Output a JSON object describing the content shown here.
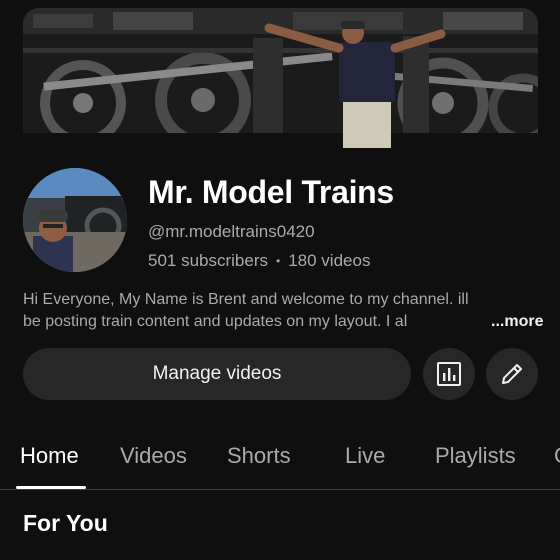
{
  "channel": {
    "name": "Mr. Model Trains",
    "handle": "@mr.modeltrains0420",
    "subscribers": "501 subscribers",
    "separator": "•",
    "videos": "180 videos",
    "description_line1": "Hi Everyone, My Name is Brent and welcome to my channel. ill",
    "description_line2": "be posting train content and updates on my layout. I al",
    "more_label": "...more"
  },
  "actions": {
    "manage_label": "Manage videos",
    "analytics_icon": "analytics-icon",
    "edit_icon": "pencil-icon"
  },
  "tabs": [
    {
      "label": "Home",
      "active": true
    },
    {
      "label": "Videos",
      "active": false
    },
    {
      "label": "Shorts",
      "active": false
    },
    {
      "label": "Live",
      "active": false
    },
    {
      "label": "Playlists",
      "active": false
    },
    {
      "label": "C",
      "active": false
    }
  ],
  "section": {
    "title": "For You"
  },
  "colors": {
    "background": "#0f0f0f",
    "button": "#272727",
    "secondary_text": "#aaaaaa",
    "primary_text": "#f1f1f1"
  }
}
